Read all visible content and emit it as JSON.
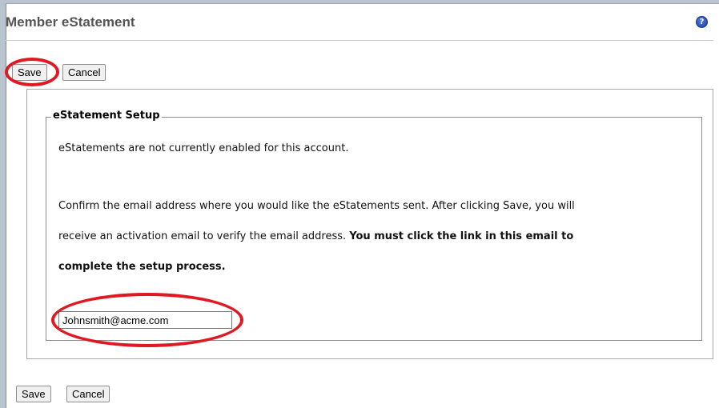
{
  "dialog": {
    "title": "Member eStatement",
    "help_icon": "help-icon"
  },
  "toolbar_top": {
    "save_label": "Save",
    "cancel_label": "Cancel"
  },
  "toolbar_bottom": {
    "save_label": "Save",
    "cancel_label": "Cancel"
  },
  "setup": {
    "legend": "eStatement Setup",
    "status_text": "eStatements are not currently enabled for this account.",
    "instruction_line1": "Confirm the email address where you would like the eStatements sent. After clicking Save, you will",
    "instruction_line2_normal": "receive an activation email to verify the email address. ",
    "instruction_line2_bold": "You must click the link in this email to",
    "instruction_line3_bold": "complete the setup process.",
    "email_value": "Johnsmith@acme.com"
  },
  "colors": {
    "annotation_circle": "#e01822",
    "help_icon": "#2a4fc4"
  }
}
